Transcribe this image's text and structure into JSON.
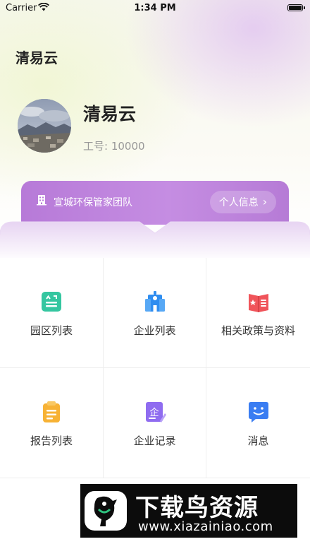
{
  "status_bar": {
    "carrier": "Carrier",
    "time": "1:34 PM"
  },
  "app_title": "清易云",
  "profile": {
    "name": "清易云",
    "id_label": "工号:",
    "id_value": "10000"
  },
  "team_banner": {
    "team_name": "宣城环保管家团队",
    "profile_button": "个人信息",
    "accent": "#b77ad8"
  },
  "menu": [
    {
      "label": "园区列表",
      "icon": "park-list-icon"
    },
    {
      "label": "企业列表",
      "icon": "enterprise-list-icon"
    },
    {
      "label": "相关政策与资料",
      "icon": "policy-book-icon"
    },
    {
      "label": "报告列表",
      "icon": "report-clipboard-icon"
    },
    {
      "label": "企业记录",
      "icon": "enterprise-record-icon"
    },
    {
      "label": "消息",
      "icon": "message-icon"
    }
  ],
  "watermark": {
    "title": "下载鸟资源",
    "url": "www.xiazainiao.com"
  }
}
